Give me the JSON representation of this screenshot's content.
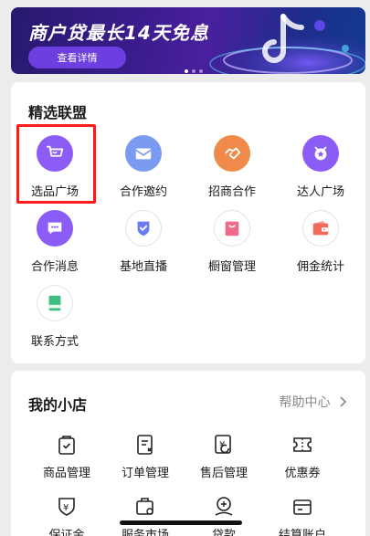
{
  "banner": {
    "title": "商户贷最长14天免息",
    "button_label": "查看详情"
  },
  "alliance": {
    "title": "精选联盟",
    "items": [
      {
        "label": "选品广场",
        "icon": "cart-icon",
        "color": "#8b5cf6"
      },
      {
        "label": "合作邀约",
        "icon": "envelope-icon",
        "color": "#7b9bf2"
      },
      {
        "label": "招商合作",
        "icon": "handshake-icon",
        "color": "#f08a4b"
      },
      {
        "label": "达人广场",
        "icon": "star-badge-icon",
        "color": "#8b5cf6"
      },
      {
        "label": "合作消息",
        "icon": "message-icon",
        "color": "#8b5cf6"
      },
      {
        "label": "基地直播",
        "icon": "shield-check-icon",
        "color": "#6b7cf0"
      },
      {
        "label": "橱窗管理",
        "icon": "shopping-bag-icon",
        "color": "#f06a8a"
      },
      {
        "label": "佣金统计",
        "icon": "wallet-icon",
        "color": "#f06a5a"
      },
      {
        "label": "联系方式",
        "icon": "contact-card-icon",
        "color": "#3fbf7f"
      }
    ]
  },
  "shop": {
    "title": "我的小店",
    "help_label": "帮助中心",
    "items": [
      {
        "label": "商品管理",
        "icon": "product-bag-icon"
      },
      {
        "label": "订单管理",
        "icon": "order-list-icon"
      },
      {
        "label": "售后管理",
        "icon": "after-sale-icon"
      },
      {
        "label": "优惠券",
        "icon": "coupon-icon"
      },
      {
        "label": "保证金",
        "icon": "deposit-shield-icon"
      },
      {
        "label": "服务市场",
        "icon": "service-market-icon"
      },
      {
        "label": "贷款",
        "icon": "loan-icon"
      },
      {
        "label": "结算账户",
        "icon": "settlement-account-icon"
      }
    ]
  }
}
